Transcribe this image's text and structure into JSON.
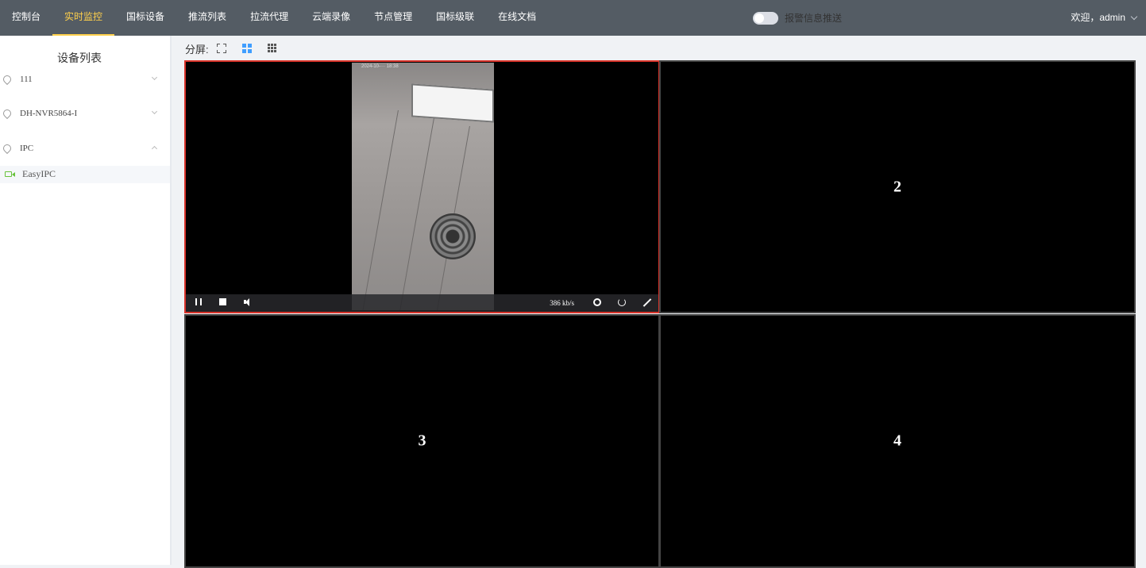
{
  "nav": {
    "items": [
      {
        "label": "控制台"
      },
      {
        "label": "实时监控"
      },
      {
        "label": "国标设备"
      },
      {
        "label": "推流列表"
      },
      {
        "label": "拉流代理"
      },
      {
        "label": "云端录像"
      },
      {
        "label": "节点管理"
      },
      {
        "label": "国标级联"
      },
      {
        "label": "在线文档"
      }
    ],
    "active_label": "实时监控",
    "alarm_push_label": "报警信息推送",
    "user_label": "欢迎，admin"
  },
  "colors": {
    "nav_bg": "#545c64",
    "nav_active": "#ffd04b",
    "active_border": "#d9342b",
    "online_icon": "#67c23a",
    "layout_active": "#409eff"
  },
  "sidebar": {
    "title": "设备列表",
    "devices": [
      {
        "label": "111",
        "icon": "location-pin-icon",
        "expanded": false
      },
      {
        "label": "DH-NVR5864-I",
        "icon": "location-pin-icon",
        "expanded": false
      },
      {
        "label": "IPC",
        "icon": "location-pin-icon",
        "expanded": true
      }
    ],
    "channels": [
      {
        "label": "EasyIPC",
        "icon": "video-camera-icon"
      }
    ]
  },
  "toolbar": {
    "split_label": "分屏:",
    "layouts": [
      "fullscreen-icon",
      "grid-4-icon",
      "grid-9-icon"
    ],
    "selected_layout": "grid-4-icon"
  },
  "screens": {
    "player": {
      "bitrate": "386 kb/s",
      "osd": "2024-10-··· 18:38"
    },
    "cells": [
      "2",
      "3",
      "4"
    ]
  }
}
